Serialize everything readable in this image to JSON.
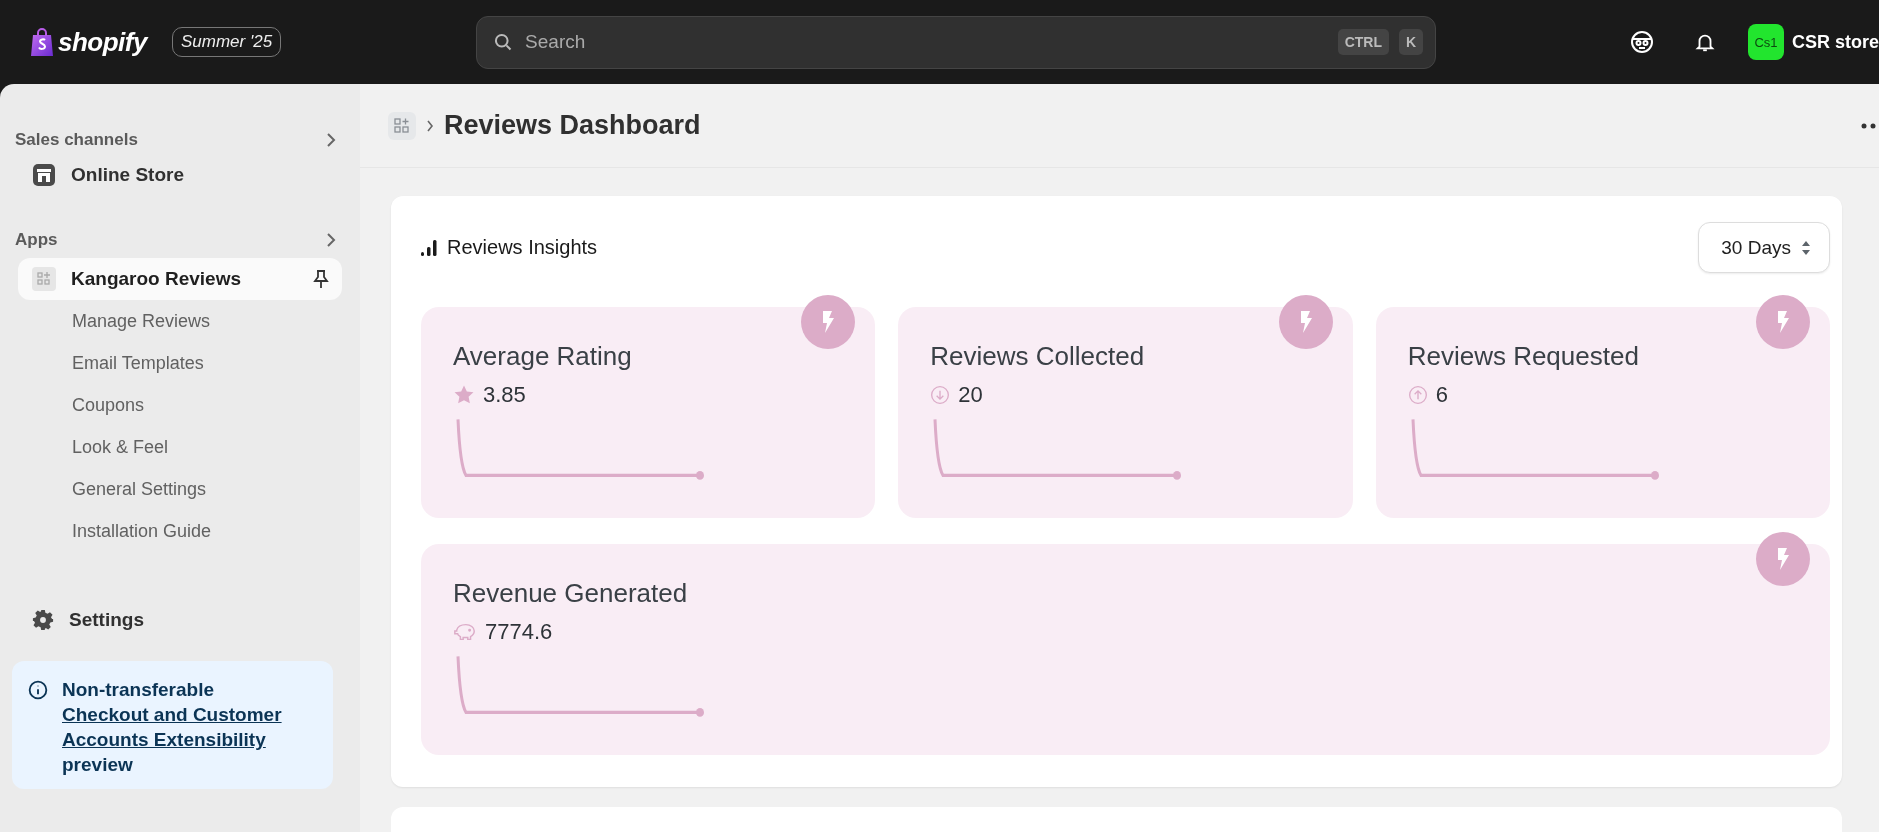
{
  "topbar": {
    "logo": "shopify",
    "edition_badge": "Summer '25",
    "search": {
      "placeholder": "Search",
      "shortcut_keys": [
        "CTRL",
        "K"
      ]
    },
    "store": {
      "initials": "Cs1",
      "name": "CSR store"
    }
  },
  "sidebar": {
    "sales_channels": {
      "title": "Sales channels",
      "items": [
        {
          "label": "Online Store",
          "selected": false
        }
      ]
    },
    "apps": {
      "title": "Apps",
      "items": [
        {
          "label": "Kangaroo Reviews",
          "selected": true,
          "pinned": true,
          "children": [
            {
              "label": "Manage Reviews",
              "selected": false
            },
            {
              "label": "Email Templates",
              "selected": false
            },
            {
              "label": "Coupons",
              "selected": false
            },
            {
              "label": "Look & Feel",
              "selected": false
            },
            {
              "label": "General Settings",
              "selected": false
            },
            {
              "label": "Installation Guide",
              "selected": false
            }
          ]
        }
      ]
    },
    "settings": {
      "label": "Settings",
      "selected": false
    },
    "banner": {
      "text": "Non-transferable",
      "link": "Checkout and Customer Accounts Extensibility",
      "suffix": "preview"
    }
  },
  "page": {
    "title": "Reviews Dashboard"
  },
  "insights": {
    "title": "Reviews Insights",
    "period": "30 Days",
    "stats": [
      {
        "title": "Average Rating",
        "value": "3.85",
        "kind": "star",
        "wide": false
      },
      {
        "title": "Reviews Collected",
        "value": "20",
        "kind": "down",
        "wide": false
      },
      {
        "title": "Reviews Requested",
        "value": "6",
        "kind": "up",
        "wide": false
      },
      {
        "title": "Revenue Generated",
        "value": "7774.6",
        "kind": "piggy",
        "wide": true
      }
    ]
  }
}
